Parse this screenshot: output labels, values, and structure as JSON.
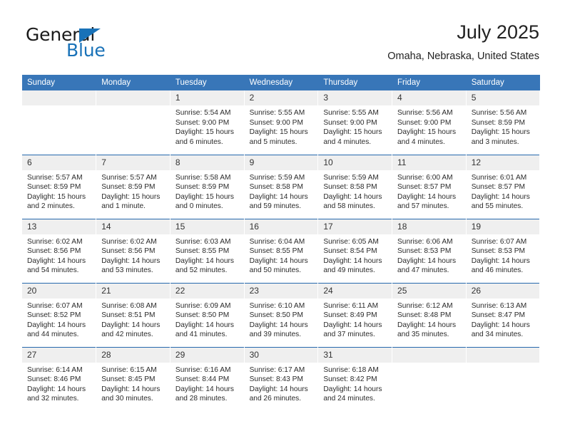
{
  "brand": {
    "name_top": "General",
    "name_bottom": "Blue",
    "accent_color": "#1972b8"
  },
  "header": {
    "title": "July 2025",
    "subtitle": "Omaha, Nebraska, United States"
  },
  "colors": {
    "header_row_background": "#3876b8",
    "header_row_text": "#ffffff",
    "week_separator": "#2668ad",
    "daynum_background": "#efefef",
    "body_text": "#2b2b2b"
  },
  "labels": {
    "sunrise_prefix": "Sunrise:",
    "sunset_prefix": "Sunset:",
    "daylight_prefix": "Daylight:"
  },
  "weekdays": [
    "Sunday",
    "Monday",
    "Tuesday",
    "Wednesday",
    "Thursday",
    "Friday",
    "Saturday"
  ],
  "weeks": [
    [
      {
        "day": "",
        "lines": []
      },
      {
        "day": "",
        "lines": []
      },
      {
        "day": "1",
        "lines": [
          "Sunrise: 5:54 AM",
          "Sunset: 9:00 PM",
          "Daylight: 15 hours",
          "and 6 minutes."
        ]
      },
      {
        "day": "2",
        "lines": [
          "Sunrise: 5:55 AM",
          "Sunset: 9:00 PM",
          "Daylight: 15 hours",
          "and 5 minutes."
        ]
      },
      {
        "day": "3",
        "lines": [
          "Sunrise: 5:55 AM",
          "Sunset: 9:00 PM",
          "Daylight: 15 hours",
          "and 4 minutes."
        ]
      },
      {
        "day": "4",
        "lines": [
          "Sunrise: 5:56 AM",
          "Sunset: 9:00 PM",
          "Daylight: 15 hours",
          "and 4 minutes."
        ]
      },
      {
        "day": "5",
        "lines": [
          "Sunrise: 5:56 AM",
          "Sunset: 8:59 PM",
          "Daylight: 15 hours",
          "and 3 minutes."
        ]
      }
    ],
    [
      {
        "day": "6",
        "lines": [
          "Sunrise: 5:57 AM",
          "Sunset: 8:59 PM",
          "Daylight: 15 hours",
          "and 2 minutes."
        ]
      },
      {
        "day": "7",
        "lines": [
          "Sunrise: 5:57 AM",
          "Sunset: 8:59 PM",
          "Daylight: 15 hours",
          "and 1 minute."
        ]
      },
      {
        "day": "8",
        "lines": [
          "Sunrise: 5:58 AM",
          "Sunset: 8:59 PM",
          "Daylight: 15 hours",
          "and 0 minutes."
        ]
      },
      {
        "day": "9",
        "lines": [
          "Sunrise: 5:59 AM",
          "Sunset: 8:58 PM",
          "Daylight: 14 hours",
          "and 59 minutes."
        ]
      },
      {
        "day": "10",
        "lines": [
          "Sunrise: 5:59 AM",
          "Sunset: 8:58 PM",
          "Daylight: 14 hours",
          "and 58 minutes."
        ]
      },
      {
        "day": "11",
        "lines": [
          "Sunrise: 6:00 AM",
          "Sunset: 8:57 PM",
          "Daylight: 14 hours",
          "and 57 minutes."
        ]
      },
      {
        "day": "12",
        "lines": [
          "Sunrise: 6:01 AM",
          "Sunset: 8:57 PM",
          "Daylight: 14 hours",
          "and 55 minutes."
        ]
      }
    ],
    [
      {
        "day": "13",
        "lines": [
          "Sunrise: 6:02 AM",
          "Sunset: 8:56 PM",
          "Daylight: 14 hours",
          "and 54 minutes."
        ]
      },
      {
        "day": "14",
        "lines": [
          "Sunrise: 6:02 AM",
          "Sunset: 8:56 PM",
          "Daylight: 14 hours",
          "and 53 minutes."
        ]
      },
      {
        "day": "15",
        "lines": [
          "Sunrise: 6:03 AM",
          "Sunset: 8:55 PM",
          "Daylight: 14 hours",
          "and 52 minutes."
        ]
      },
      {
        "day": "16",
        "lines": [
          "Sunrise: 6:04 AM",
          "Sunset: 8:55 PM",
          "Daylight: 14 hours",
          "and 50 minutes."
        ]
      },
      {
        "day": "17",
        "lines": [
          "Sunrise: 6:05 AM",
          "Sunset: 8:54 PM",
          "Daylight: 14 hours",
          "and 49 minutes."
        ]
      },
      {
        "day": "18",
        "lines": [
          "Sunrise: 6:06 AM",
          "Sunset: 8:53 PM",
          "Daylight: 14 hours",
          "and 47 minutes."
        ]
      },
      {
        "day": "19",
        "lines": [
          "Sunrise: 6:07 AM",
          "Sunset: 8:53 PM",
          "Daylight: 14 hours",
          "and 46 minutes."
        ]
      }
    ],
    [
      {
        "day": "20",
        "lines": [
          "Sunrise: 6:07 AM",
          "Sunset: 8:52 PM",
          "Daylight: 14 hours",
          "and 44 minutes."
        ]
      },
      {
        "day": "21",
        "lines": [
          "Sunrise: 6:08 AM",
          "Sunset: 8:51 PM",
          "Daylight: 14 hours",
          "and 42 minutes."
        ]
      },
      {
        "day": "22",
        "lines": [
          "Sunrise: 6:09 AM",
          "Sunset: 8:50 PM",
          "Daylight: 14 hours",
          "and 41 minutes."
        ]
      },
      {
        "day": "23",
        "lines": [
          "Sunrise: 6:10 AM",
          "Sunset: 8:50 PM",
          "Daylight: 14 hours",
          "and 39 minutes."
        ]
      },
      {
        "day": "24",
        "lines": [
          "Sunrise: 6:11 AM",
          "Sunset: 8:49 PM",
          "Daylight: 14 hours",
          "and 37 minutes."
        ]
      },
      {
        "day": "25",
        "lines": [
          "Sunrise: 6:12 AM",
          "Sunset: 8:48 PM",
          "Daylight: 14 hours",
          "and 35 minutes."
        ]
      },
      {
        "day": "26",
        "lines": [
          "Sunrise: 6:13 AM",
          "Sunset: 8:47 PM",
          "Daylight: 14 hours",
          "and 34 minutes."
        ]
      }
    ],
    [
      {
        "day": "27",
        "lines": [
          "Sunrise: 6:14 AM",
          "Sunset: 8:46 PM",
          "Daylight: 14 hours",
          "and 32 minutes."
        ]
      },
      {
        "day": "28",
        "lines": [
          "Sunrise: 6:15 AM",
          "Sunset: 8:45 PM",
          "Daylight: 14 hours",
          "and 30 minutes."
        ]
      },
      {
        "day": "29",
        "lines": [
          "Sunrise: 6:16 AM",
          "Sunset: 8:44 PM",
          "Daylight: 14 hours",
          "and 28 minutes."
        ]
      },
      {
        "day": "30",
        "lines": [
          "Sunrise: 6:17 AM",
          "Sunset: 8:43 PM",
          "Daylight: 14 hours",
          "and 26 minutes."
        ]
      },
      {
        "day": "31",
        "lines": [
          "Sunrise: 6:18 AM",
          "Sunset: 8:42 PM",
          "Daylight: 14 hours",
          "and 24 minutes."
        ]
      },
      {
        "day": "",
        "lines": []
      },
      {
        "day": "",
        "lines": []
      }
    ]
  ]
}
